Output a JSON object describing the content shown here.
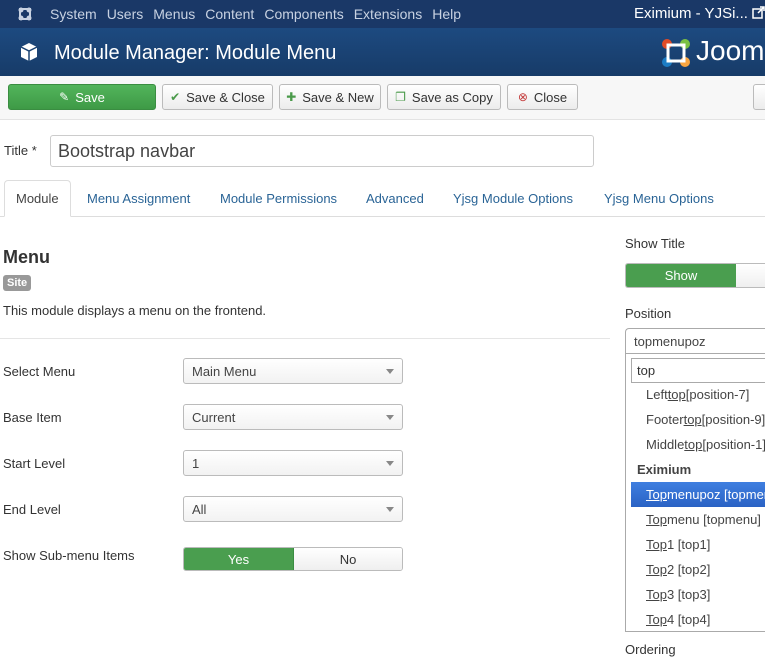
{
  "topnav": {
    "menu": [
      "System",
      "Users",
      "Menus",
      "Content",
      "Components",
      "Extensions",
      "Help"
    ],
    "site_name": "Eximium - YJSi..."
  },
  "header": {
    "title": "Module Manager: Module Menu",
    "brand": "Joom"
  },
  "toolbar": {
    "save": "Save",
    "save_close": "Save & Close",
    "save_new": "Save & New",
    "save_copy": "Save as Copy",
    "close": "Close"
  },
  "title_field": {
    "label": "Title *",
    "value": "Bootstrap navbar"
  },
  "tabs": [
    "Module",
    "Menu Assignment",
    "Module Permissions",
    "Advanced",
    "Yjsg Module Options",
    "Yjsg Menu Options"
  ],
  "module": {
    "heading": "Menu",
    "badge": "Site",
    "description": "This module displays a menu on the frontend."
  },
  "fields": {
    "select_menu": {
      "label": "Select Menu",
      "value": "Main Menu"
    },
    "base_item": {
      "label": "Base Item",
      "value": "Current"
    },
    "start_level": {
      "label": "Start Level",
      "value": "1"
    },
    "end_level": {
      "label": "End Level",
      "value": "All"
    },
    "show_submenu": {
      "label": "Show Sub-menu Items",
      "yes": "Yes",
      "no": "No",
      "selected": "Yes"
    }
  },
  "right": {
    "show_title_label": "Show Title",
    "show_label": "Show",
    "show_selected": "Show",
    "position_label": "Position",
    "position_value": "topmenupoz",
    "search_value": "top",
    "items_a": [
      {
        "pre": "Left ",
        "match": "top",
        "post": " [position-7]"
      },
      {
        "pre": "Footer ",
        "match": "top",
        "post": " [position-9]"
      },
      {
        "pre": "Middle ",
        "match": "top",
        "post": " [position-1]"
      }
    ],
    "group_label": "Eximium",
    "items_b": [
      {
        "pre": "",
        "match": "Top",
        "post": "menupoz [topmenupoz]"
      },
      {
        "pre": "",
        "match": "Top",
        "post": "menu [topmenu]"
      },
      {
        "pre": "",
        "match": "Top",
        "post": "1 [top1]"
      },
      {
        "pre": "",
        "match": "Top",
        "post": " 2 [top2]"
      },
      {
        "pre": "",
        "match": "Top",
        "post": " 3 [top3]"
      },
      {
        "pre": "",
        "match": "Top",
        "post": " 4 [top4]"
      }
    ],
    "ordering_label": "Ordering"
  }
}
